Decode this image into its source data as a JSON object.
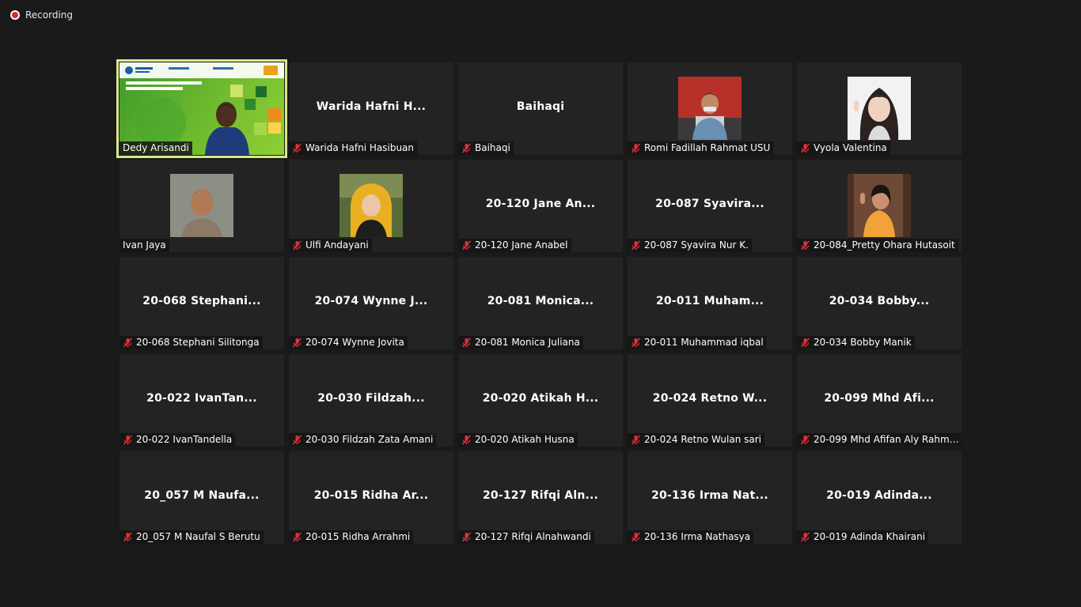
{
  "recording": {
    "label": "Recording"
  },
  "participants": [
    {
      "display": "",
      "label": "Dedy Arisandi",
      "muted": false,
      "kind": "video"
    },
    {
      "display": "Warida  Hafni  H...",
      "label": "Warida Hafni Hasibuan",
      "muted": true,
      "kind": "name"
    },
    {
      "display": "Baihaqi",
      "label": "Baihaqi",
      "muted": true,
      "kind": "name"
    },
    {
      "display": "",
      "label": "Romi Fadillah Rahmat USU",
      "muted": true,
      "kind": "photo"
    },
    {
      "display": "",
      "label": "Vyola Valentina",
      "muted": true,
      "kind": "photo"
    },
    {
      "display": "",
      "label": "Ivan Jaya",
      "muted": false,
      "kind": "photo"
    },
    {
      "display": "",
      "label": "Ulfi Andayani",
      "muted": true,
      "kind": "photo"
    },
    {
      "display": "20-120 Jane An...",
      "label": "20-120 Jane Anabel",
      "muted": true,
      "kind": "name"
    },
    {
      "display": "20-087  Syavira...",
      "label": "20-087 Syavira Nur K.",
      "muted": true,
      "kind": "name"
    },
    {
      "display": "",
      "label": "20-084_Pretty Ohara Hutasoit",
      "muted": true,
      "kind": "photo"
    },
    {
      "display": "20-068  Stephani...",
      "label": "20-068 Stephani Silitonga",
      "muted": true,
      "kind": "name"
    },
    {
      "display": "20-074  Wynne J...",
      "label": "20-074 Wynne Jovita",
      "muted": true,
      "kind": "name"
    },
    {
      "display": "20-081  Monica...",
      "label": "20-081 Monica Juliana",
      "muted": true,
      "kind": "name"
    },
    {
      "display": "20-011  Muham...",
      "label": "20-011 Muhammad iqbal",
      "muted": true,
      "kind": "name"
    },
    {
      "display": "20-034  Bobby...",
      "label": "20-034 Bobby Manik",
      "muted": true,
      "kind": "name"
    },
    {
      "display": "20-022  IvanTan...",
      "label": "20-022 IvanTandella",
      "muted": true,
      "kind": "name"
    },
    {
      "display": "20-030  Fildzah...",
      "label": "20-030 Fildzah Zata Amani",
      "muted": true,
      "kind": "name"
    },
    {
      "display": "20-020  Atikah H...",
      "label": "20-020 Atikah Husna",
      "muted": true,
      "kind": "name"
    },
    {
      "display": "20-024  Retno W...",
      "label": "20-024 Retno Wulan sari",
      "muted": true,
      "kind": "name"
    },
    {
      "display": "20-099  Mhd Afi...",
      "label": "20-099 Mhd Afifan Aly Rahma...",
      "muted": true,
      "kind": "name"
    },
    {
      "display": "20_057  M Naufa...",
      "label": "20_057 M Naufal S Berutu",
      "muted": true,
      "kind": "name"
    },
    {
      "display": "20-015  Ridha Ar...",
      "label": "20-015 Ridha Arrahmi",
      "muted": true,
      "kind": "name"
    },
    {
      "display": "20-127  Rifqi Aln...",
      "label": "20-127 Rifqi Alnahwandi",
      "muted": true,
      "kind": "name"
    },
    {
      "display": "20-136  Irma Nat...",
      "label": "20-136 Irma Nathasya",
      "muted": true,
      "kind": "name"
    },
    {
      "display": "20-019  Adinda...",
      "label": "20-019 Adinda Khairani",
      "muted": true,
      "kind": "name"
    }
  ],
  "colors": {
    "active_speaker": "#d8e78c",
    "mute": "#e0303a",
    "tile": "#232323",
    "background": "#1a1a1a"
  }
}
